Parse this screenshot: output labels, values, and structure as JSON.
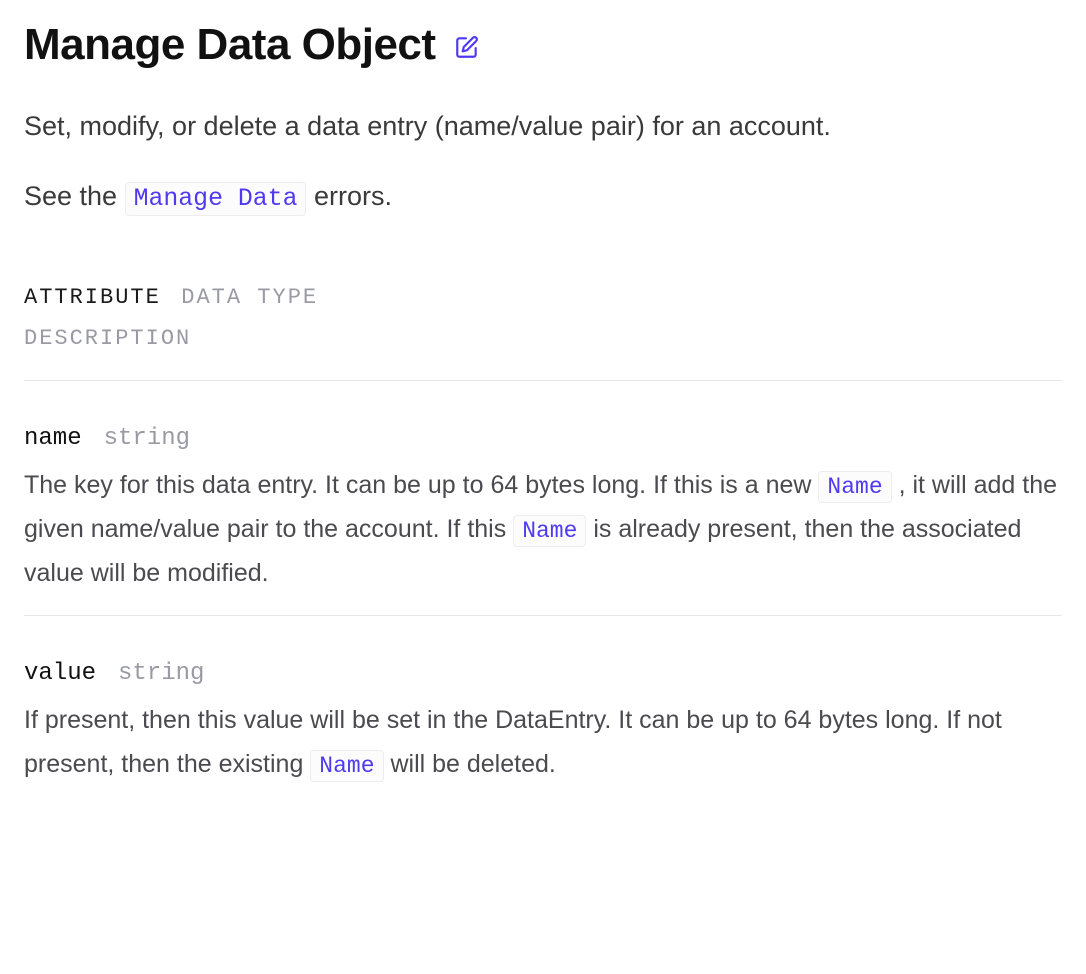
{
  "page": {
    "title": "Manage Data Object",
    "lead": "Set, modify, or delete a data entry (name/value pair) for an account.",
    "see_prefix": "See the ",
    "see_code": "Manage Data",
    "see_suffix": " errors."
  },
  "columns": {
    "attribute": "ATTRIBUTE",
    "data_type": "DATA TYPE",
    "description": "DESCRIPTION"
  },
  "attributes": [
    {
      "name": "name",
      "type": "string",
      "desc_parts": [
        {
          "text": "The key for this data entry. It can be up to 64 bytes long. If this is a new "
        },
        {
          "code": "Name"
        },
        {
          "text": " , it will add the given name/value pair to the account. If this "
        },
        {
          "code": "Name"
        },
        {
          "text": " is already present, then the associated value will be modified."
        }
      ]
    },
    {
      "name": "value",
      "type": "string",
      "desc_parts": [
        {
          "text": "If present, then this value will be set in the DataEntry. It can be up to 64 bytes long. If not present, then the existing "
        },
        {
          "code": "Name"
        },
        {
          "text": " will be deleted."
        }
      ]
    }
  ]
}
